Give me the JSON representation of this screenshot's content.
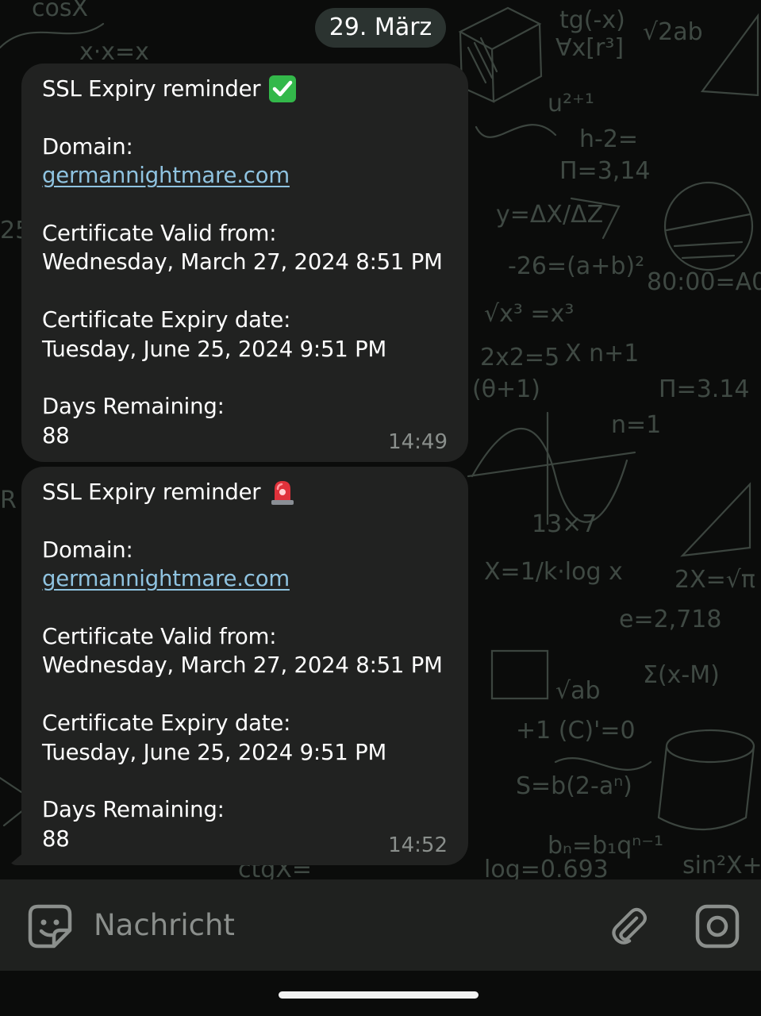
{
  "chat": {
    "date_label": "29. März",
    "messages": [
      {
        "title": "SSL Expiry reminder",
        "emoji": "check-mark-button",
        "domain_label": "Domain:",
        "domain": "germannightmare.com",
        "valid_from_label": "Certificate Valid from:",
        "valid_from": "Wednesday, March 27, 2024 8:51 PM",
        "expiry_label": "Certificate Expiry date:",
        "expiry": "Tuesday, June 25, 2024 9:51 PM",
        "days_label": "Days Remaining:",
        "days": "88",
        "time": "14:49"
      },
      {
        "title": "SSL Expiry reminder",
        "emoji": "police-car-light",
        "domain_label": "Domain:",
        "domain": "germannightmare.com",
        "valid_from_label": "Certificate Valid from:",
        "valid_from": "Wednesday, March 27, 2024 8:51 PM",
        "expiry_label": "Certificate Expiry date:",
        "expiry": "Tuesday, June 25, 2024 9:51 PM",
        "days_label": "Days Remaining:",
        "days": "88",
        "time": "14:52"
      }
    ]
  },
  "composer": {
    "placeholder": "Nachricht",
    "icons": [
      "sticker-icon",
      "paperclip-icon",
      "camera-icon"
    ]
  },
  "colors": {
    "bubble": "#212221",
    "link": "#8fc3e0",
    "date_pill": "#2b3330",
    "composer": "#1f211f"
  }
}
